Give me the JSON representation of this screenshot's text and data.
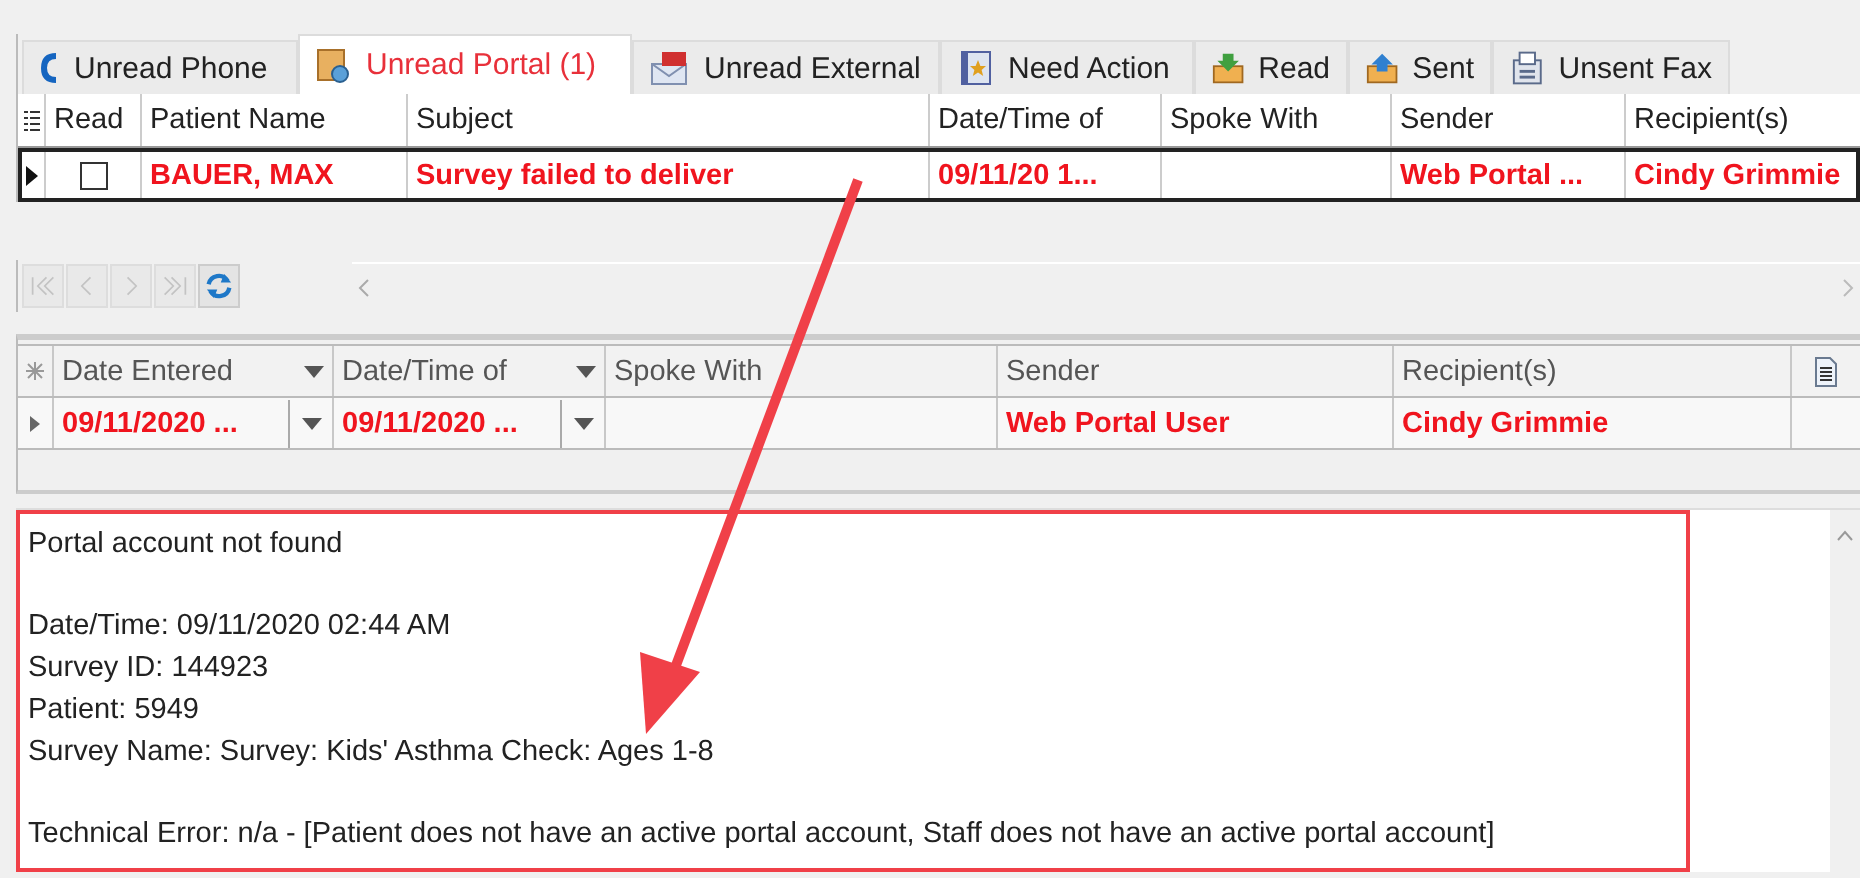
{
  "tabs": [
    {
      "label": "Unread Phone",
      "selected": false
    },
    {
      "label": "Unread Portal (1)",
      "selected": true
    },
    {
      "label": "Unread External",
      "selected": false
    },
    {
      "label": "Need Action",
      "selected": false
    },
    {
      "label": "Read",
      "selected": false
    },
    {
      "label": "Sent",
      "selected": false
    },
    {
      "label": "Unsent Fax",
      "selected": false
    }
  ],
  "message_grid": {
    "columns": [
      "Read",
      "Patient Name",
      "Subject",
      "Date/Time of",
      "Spoke With",
      "Sender",
      "Recipient(s)"
    ],
    "rows": [
      {
        "selected": true,
        "read": false,
        "cells": [
          "",
          "BAUER, MAX",
          "Survey failed to deliver",
          "09/11/20 1...",
          "",
          "Web Portal ...",
          "Cindy Grimmie"
        ]
      }
    ]
  },
  "nav_buttons": [
    {
      "disabled": true
    },
    {
      "disabled": true
    },
    {
      "disabled": true
    },
    {
      "disabled": true
    },
    {
      "disabled": false
    }
  ],
  "detail_grid": {
    "columns": [
      {
        "label": "Date Entered",
        "dropdown": true
      },
      {
        "label": "Date/Time of",
        "dropdown": true
      },
      {
        "label": "Spoke With",
        "dropdown": false
      },
      {
        "label": "Sender",
        "dropdown": false
      },
      {
        "label": "Recipient(s)",
        "dropdown": false
      }
    ],
    "rows": [
      {
        "selected": true,
        "cells": [
          "09/11/2020 ...",
          "09/11/2020 ...",
          "",
          "Web Portal User",
          "Cindy Grimmie"
        ]
      }
    ]
  },
  "message_body": {
    "paragraphs": [
      [
        "Portal account not found"
      ],
      [
        "Date/Time: 09/11/2020 02:44 AM",
        "Survey ID: 144923",
        "Patient: 5949",
        "Survey Name: Survey: Kids' Asthma Check: Ages 1-8"
      ],
      [
        "Technical Error: n/a - [Patient does not have an active portal account, Staff does not have an active portal account]"
      ]
    ]
  }
}
